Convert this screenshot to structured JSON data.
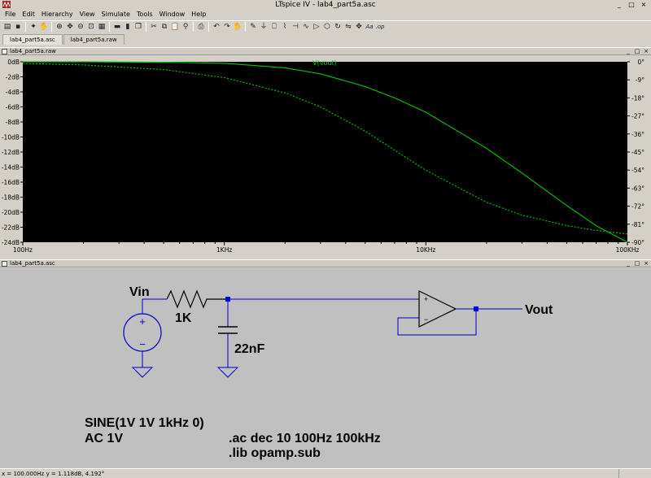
{
  "window": {
    "title": "LTspice IV - lab4_part5a.asc"
  },
  "menu": [
    "File",
    "Edit",
    "Hierarchy",
    "View",
    "Simulate",
    "Tools",
    "Window",
    "Help"
  ],
  "toolbar": {
    "buttons": [
      {
        "name": "open-icon",
        "glyph": "▤"
      },
      {
        "name": "save-icon",
        "glyph": "▪"
      },
      {
        "name": "run-icon",
        "glyph": "✦"
      },
      {
        "name": "halt-icon",
        "glyph": "✋"
      },
      {
        "name": "zoom-in-icon",
        "glyph": "⊕"
      },
      {
        "name": "pan-icon",
        "glyph": "✥"
      },
      {
        "name": "zoom-out-icon",
        "glyph": "⊖"
      },
      {
        "name": "zoom-fit-icon",
        "glyph": "⊡"
      },
      {
        "name": "grid-icon",
        "glyph": "▦"
      },
      {
        "name": "tile-horizontal-icon",
        "glyph": "▬"
      },
      {
        "name": "tile-vertical-icon",
        "glyph": "▮"
      },
      {
        "name": "cascade-icon",
        "glyph": "❐"
      },
      {
        "name": "cut-icon",
        "glyph": "✂"
      },
      {
        "name": "copy-icon",
        "glyph": "⧉"
      },
      {
        "name": "paste-icon",
        "glyph": "📋"
      },
      {
        "name": "find-icon",
        "glyph": "⚲"
      },
      {
        "name": "print-icon",
        "glyph": "⎙"
      },
      {
        "name": "undo-icon",
        "glyph": "↶"
      },
      {
        "name": "redo-icon",
        "glyph": "↷"
      },
      {
        "name": "drag-icon",
        "glyph": "✋"
      },
      {
        "name": "wire-icon",
        "glyph": "✎"
      },
      {
        "name": "ground-icon",
        "glyph": "⏚"
      },
      {
        "name": "label-net-icon",
        "glyph": "⎕"
      },
      {
        "name": "resistor-icon",
        "glyph": "⌇"
      },
      {
        "name": "capacitor-icon",
        "glyph": "⊣"
      },
      {
        "name": "inductor-icon",
        "glyph": "∿"
      },
      {
        "name": "diode-icon",
        "glyph": "▷"
      },
      {
        "name": "component-icon",
        "glyph": "⬡"
      },
      {
        "name": "rotate-icon",
        "glyph": "↻"
      },
      {
        "name": "mirror-icon",
        "glyph": "⇋"
      },
      {
        "name": "move-icon",
        "glyph": "✥"
      },
      {
        "name": "text-icon",
        "glyph": "Aa"
      },
      {
        "name": "spice-directive-icon",
        "glyph": ".op"
      }
    ]
  },
  "tabs": [
    "lab4_part5a.asc",
    "lab4_part5a.raw"
  ],
  "plot_pane": {
    "title": "lab4_part5a.raw"
  },
  "schematic_pane": {
    "title": "lab4_part5a.asc"
  },
  "status": {
    "text": "x = 100.000Hz    y = 1.118dB, 4.192°"
  },
  "colors": {
    "trace": "#00c800",
    "plot_bg": "#000000",
    "schematic_bg": "#c0c0c0",
    "wire": "#0000c8",
    "junction": "#0000ff"
  },
  "chart_data": {
    "type": "line",
    "title": "V(vout)",
    "xlabel": "",
    "ylabel": "",
    "x_scale": "log",
    "xlim": [
      100,
      100000
    ],
    "x_ticks": [
      "100Hz",
      "1KHz",
      "10KHz",
      "100KHz"
    ],
    "ylim_left": [
      -24,
      0
    ],
    "y_ticks_left": [
      "0dB",
      "-2dB",
      "-4dB",
      "-6dB",
      "-8dB",
      "-10dB",
      "-12dB",
      "-14dB",
      "-16dB",
      "-18dB",
      "-20dB",
      "-22dB",
      "-24dB"
    ],
    "ylim_right": [
      -90,
      0
    ],
    "y_ticks_right": [
      "0°",
      "-9°",
      "-18°",
      "-27°",
      "-36°",
      "-45°",
      "-54°",
      "-63°",
      "-72°",
      "-81°",
      "-90°"
    ],
    "series": [
      {
        "name": "V(vout)",
        "axis": "magnitude",
        "style": "solid",
        "x": [
          100,
          200,
          500,
          1000,
          2000,
          3000,
          5000,
          7000,
          10000,
          20000,
          30000,
          50000,
          70000,
          100000
        ],
        "y": [
          0.0,
          0.0,
          -0.06,
          -0.2,
          -0.8,
          -1.6,
          -3.3,
          -4.8,
          -6.7,
          -11.5,
          -14.8,
          -19.1,
          -21.8,
          -24.0
        ]
      },
      {
        "name": "V(vout)",
        "axis": "phase",
        "style": "dashed",
        "x": [
          100,
          200,
          500,
          1000,
          2000,
          3000,
          5000,
          7000,
          10000,
          20000,
          30000,
          50000,
          70000,
          100000
        ],
        "y": [
          -0.8,
          -1.6,
          -3.9,
          -7.9,
          -15.5,
          -22.5,
          -34.6,
          -44.1,
          -54.1,
          -70.1,
          -76.5,
          -81.7,
          -84.1,
          -85.9
        ]
      }
    ]
  },
  "schematic": {
    "labels": {
      "vin": "Vin",
      "vout": "Vout",
      "resistor_value": "1K",
      "capacitor_value": "22nF",
      "source_plus": "+",
      "source_minus": "−",
      "opamp_plus": "+",
      "opamp_minus": "−"
    },
    "directives": {
      "sine": "SINE(1V 1V 1kHz 0)",
      "ac_value": "AC 1V",
      "ac_analysis": ".ac dec 10 100Hz 100kHz",
      "lib": ".lib opamp.sub"
    }
  }
}
